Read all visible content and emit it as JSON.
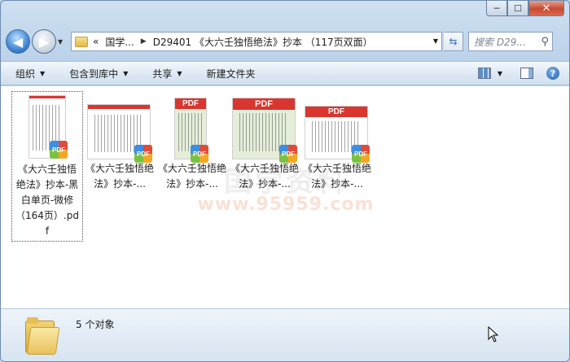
{
  "window": {
    "caption": {
      "minimize_glyph": "─",
      "maximize_glyph": "☐",
      "close_glyph": "✕"
    }
  },
  "nav": {
    "back_glyph": "◀",
    "forward_glyph": "▶",
    "breadcrumbs": [
      "«",
      "国学...",
      "D29401 《大六壬独悟绝法》抄本 （117页双面）"
    ],
    "search_placeholder": "搜索 D29..."
  },
  "toolbar": {
    "organize": "组织",
    "include_in_library": "包含到库中",
    "share": "共享",
    "new_folder": "新建文件夹"
  },
  "watermark": {
    "text": "国学资料",
    "url": "www.95959.com"
  },
  "files": [
    {
      "label": "《大六壬独悟绝法》抄本-黑白单页-微修（164页）.pdf",
      "selected": true,
      "thumb": "portrait-white"
    },
    {
      "label": "《大六壬独悟绝法》抄本-...",
      "selected": false,
      "thumb": "landscape-white"
    },
    {
      "label": "《大六壬独悟绝法》抄本-...",
      "selected": false,
      "thumb": "portrait-green"
    },
    {
      "label": "《大六壬独悟绝法》抄本-...",
      "selected": false,
      "thumb": "landscape-green"
    },
    {
      "label": "《大六壬独悟绝法》抄本-...",
      "selected": false,
      "thumb": "landscape-white-2"
    }
  ],
  "pdf_badge_text": "PDF",
  "details": {
    "status": "5 个对象"
  },
  "colors": {
    "accent": "#3f86d6",
    "pdf_red": "#d9362f"
  }
}
